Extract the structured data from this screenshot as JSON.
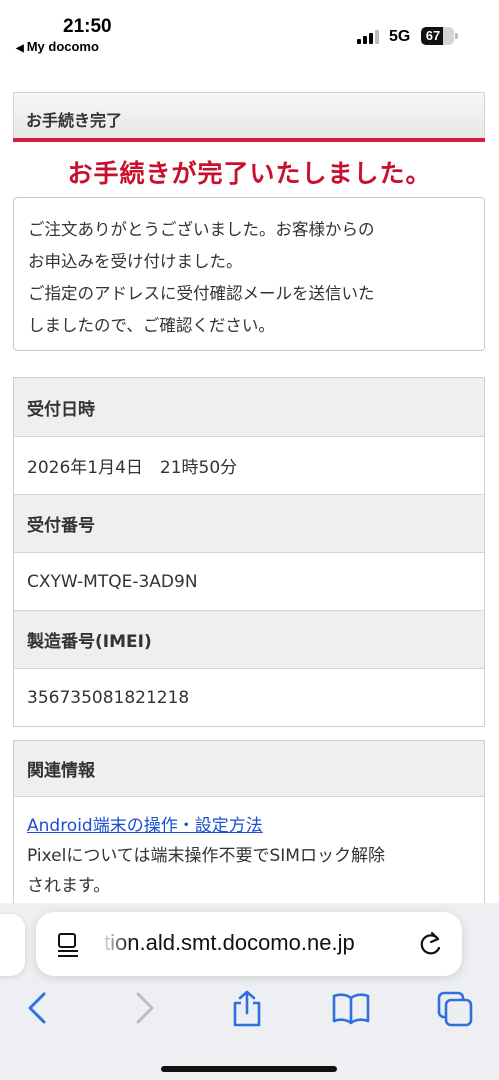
{
  "status": {
    "time": "21:50",
    "back_app": "My docomo",
    "network": "5G",
    "battery_percent": 67,
    "battery_label": "67"
  },
  "page": {
    "section_title": "お手続き完了",
    "complete_title": "お手続きが完了いたしました。",
    "message_lines": [
      "ご注文ありがとうございました。お客様からの",
      "お申込みを受け付けました。",
      "ご指定のアドレスに受付確認メールを送信いた",
      "しましたので、ご確認ください。"
    ],
    "fields": [
      {
        "label": "受付日時",
        "value": "2026年1月4日　21時50分"
      },
      {
        "label": "受付番号",
        "value": "CXYW-MTQE-3AD9N"
      },
      {
        "label": "製造番号(IMEI)",
        "value": "356735081821218"
      }
    ],
    "related": {
      "title": "関連情報",
      "link_text": "Android端末の操作・設定方法",
      "note_lines": [
        "Pixelについては端末操作不要でSIMロック解除",
        "されます。"
      ]
    }
  },
  "browser": {
    "url_display": "tion.ald.smt.docomo.ne.jp",
    "toolbar_icons": [
      "back-icon",
      "forward-icon",
      "share-icon",
      "bookmarks-icon",
      "tabs-icon"
    ],
    "colors": {
      "accent_red": "#c8102e",
      "link_blue": "#1a4fd0",
      "toolbar_blue": "#2f6fe0"
    }
  }
}
